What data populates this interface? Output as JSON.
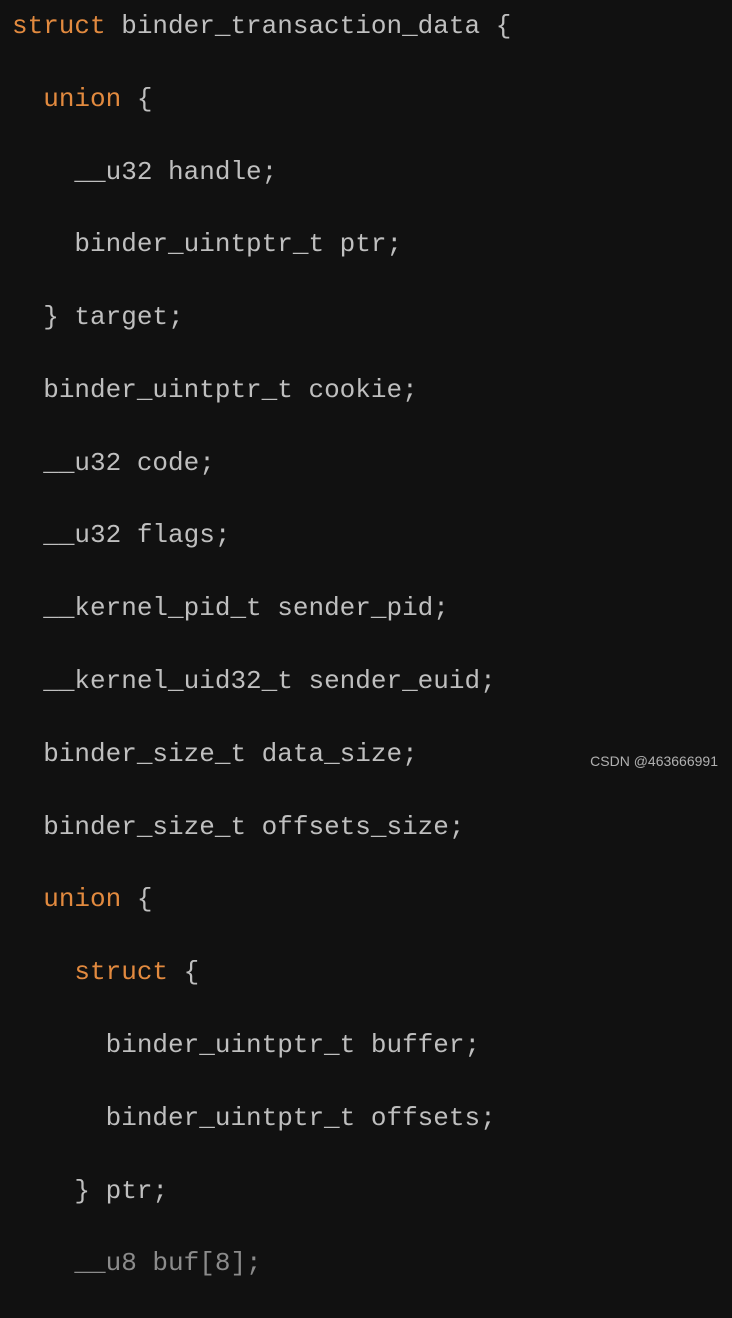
{
  "code": {
    "lines": [
      {
        "indent": 0,
        "tokens": [
          {
            "t": "struct",
            "c": "kw"
          },
          {
            "t": " binder_transaction_data {",
            "c": "txt"
          }
        ]
      },
      {
        "indent": 1,
        "tokens": [
          {
            "t": "union",
            "c": "kw"
          },
          {
            "t": " {",
            "c": "txt"
          }
        ]
      },
      {
        "indent": 2,
        "tokens": [
          {
            "t": "__u32 handle;",
            "c": "txt"
          }
        ]
      },
      {
        "indent": 2,
        "tokens": [
          {
            "t": "binder_uintptr_t ptr;",
            "c": "txt"
          }
        ]
      },
      {
        "indent": 1,
        "tokens": [
          {
            "t": "} target;",
            "c": "txt"
          }
        ]
      },
      {
        "indent": 1,
        "tokens": [
          {
            "t": "binder_uintptr_t cookie;",
            "c": "txt"
          }
        ]
      },
      {
        "indent": 1,
        "tokens": [
          {
            "t": "__u32 code;",
            "c": "txt"
          }
        ]
      },
      {
        "indent": 1,
        "tokens": [
          {
            "t": "__u32 flags;",
            "c": "txt"
          }
        ]
      },
      {
        "indent": 1,
        "tokens": [
          {
            "t": "__kernel_pid_t sender_pid;",
            "c": "txt"
          }
        ]
      },
      {
        "indent": 1,
        "tokens": [
          {
            "t": "__kernel_uid32_t sender_euid;",
            "c": "txt"
          }
        ]
      },
      {
        "indent": 1,
        "tokens": [
          {
            "t": "binder_size_t data_size;",
            "c": "txt"
          }
        ]
      },
      {
        "indent": 1,
        "tokens": [
          {
            "t": "binder_size_t offsets_size;",
            "c": "txt"
          }
        ]
      },
      {
        "indent": 1,
        "tokens": [
          {
            "t": "union",
            "c": "kw"
          },
          {
            "t": " {",
            "c": "txt"
          }
        ]
      },
      {
        "indent": 2,
        "tokens": [
          {
            "t": "struct",
            "c": "kw"
          },
          {
            "t": " {",
            "c": "txt"
          }
        ]
      },
      {
        "indent": 3,
        "tokens": [
          {
            "t": "binder_uintptr_t buffer;",
            "c": "txt"
          }
        ]
      },
      {
        "indent": 3,
        "tokens": [
          {
            "t": "binder_uintptr_t offsets;",
            "c": "txt"
          }
        ]
      },
      {
        "indent": 2,
        "tokens": [
          {
            "t": "} ptr;",
            "c": "txt"
          }
        ]
      },
      {
        "indent": 2,
        "tokens": [
          {
            "t": "__u8 buf[8];",
            "c": "txt"
          }
        ],
        "partial": true
      }
    ],
    "indentUnit": "  "
  },
  "watermark": "CSDN @463666991"
}
